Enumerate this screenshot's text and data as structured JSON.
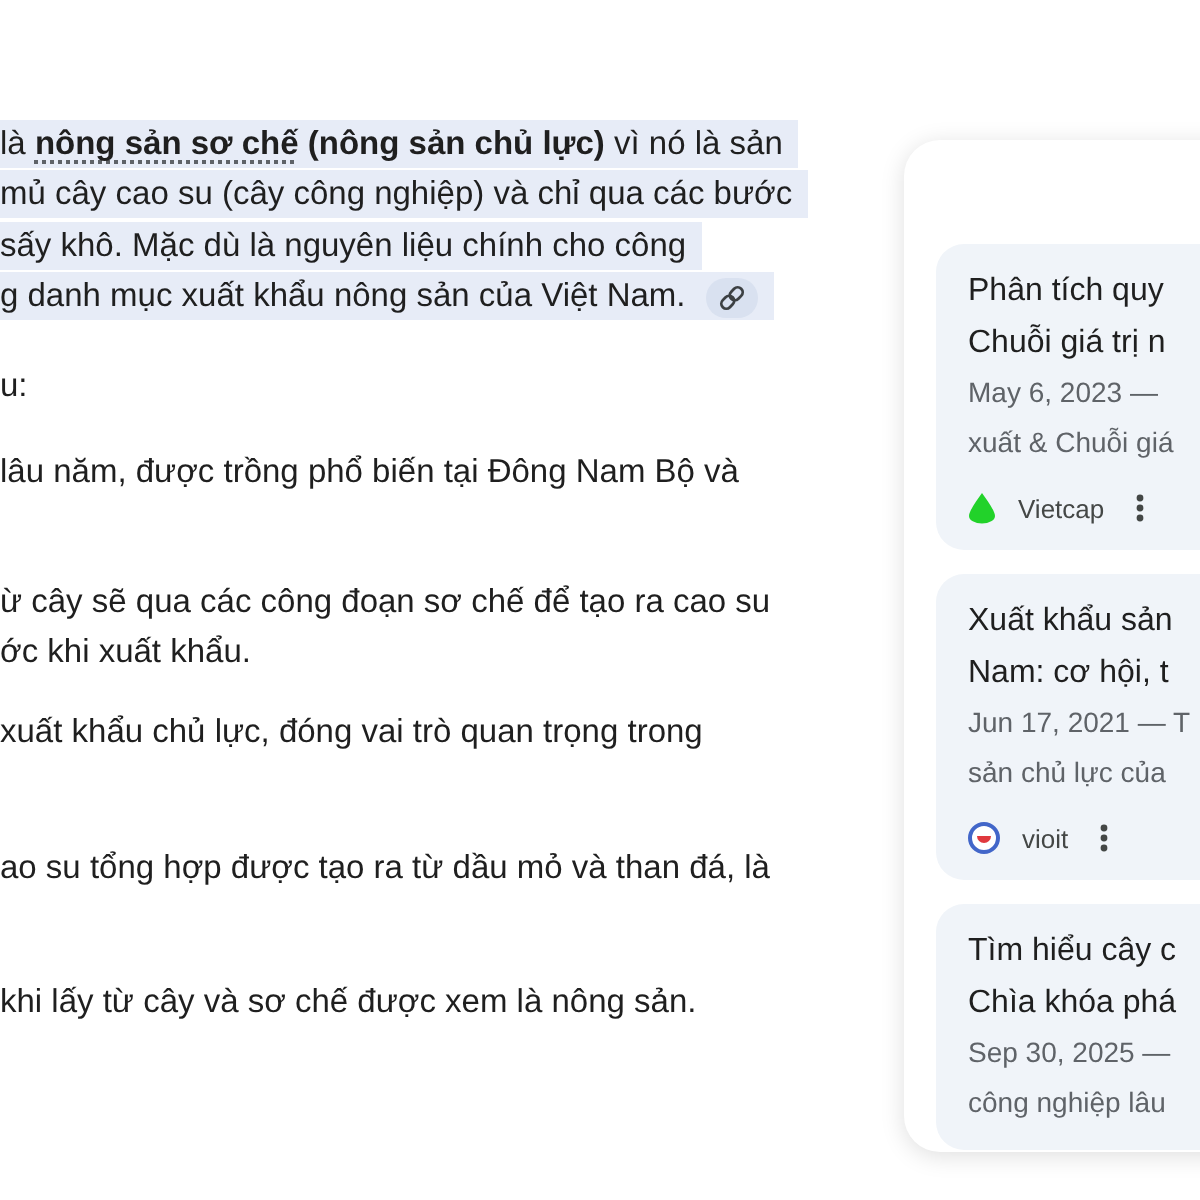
{
  "answer": {
    "summary": {
      "highlighted": true,
      "lead": "là ",
      "term": "nông sản sơ chế",
      "rest": " **(nông sản chủ lực)** vì nó là sản",
      "lines": [
        "mủ cây cao su (cây công nghiệp) và chỉ qua các bước",
        "sấy khô. Mặc dù là nguyên liệu chính cho công",
        "g danh mục xuất khẩu nông sản của Việt Nam."
      ]
    },
    "intro": "u:",
    "points": [
      {
        "lines": [
          "lâu năm, được trồng phổ biến tại Đông Nam Bộ và"
        ]
      },
      {
        "lines": [
          "ừ cây sẽ qua các công đoạn sơ chế để tạo ra cao su",
          "ớc khi xuất khẩu."
        ]
      },
      {
        "lines": [
          "xuất khẩu chủ lực, đóng vai trò quan trọng trong"
        ]
      },
      {
        "lines": [
          "ao su tổng hợp được tạo ra từ dầu mỏ và than đá, là"
        ]
      },
      {
        "lines": [
          "khi lấy từ cây và sơ chế được xem là nông sản."
        ]
      }
    ]
  },
  "sources": [
    {
      "title": [
        "Phân tích quy",
        "Chuỗi giá trị n"
      ],
      "snippet": [
        "May 6, 2023 —",
        "xuất & Chuỗi giá"
      ],
      "source": {
        "kind": "drop",
        "name": "Vietcap"
      }
    },
    {
      "title": [
        "Xuất khẩu sản",
        "Nam: cơ hội, t"
      ],
      "snippet": [
        "Jun 17, 2021 — T",
        "sản chủ lực của"
      ],
      "source": {
        "kind": "ring",
        "name": "vioit"
      }
    },
    {
      "title": [
        "Tìm hiểu cây c",
        "Chìa khóa phá"
      ],
      "snippet": [
        "Sep 30, 2025 —",
        "công nghiệp lâu"
      ]
    }
  ]
}
